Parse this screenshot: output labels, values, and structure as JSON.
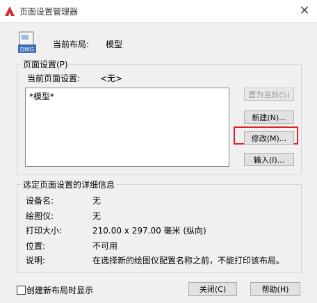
{
  "window": {
    "title": "页面设置管理器",
    "close_glyph": "✕"
  },
  "current_layout": {
    "label": "当前布局:",
    "value": "模型"
  },
  "page_setup": {
    "group_title": "页面设置(P)",
    "current_label": "当前页面设置:",
    "current_value": "<无>",
    "list_items": [
      "*模型*"
    ],
    "buttons": {
      "set_current": "置为当前(S)",
      "new": "新建(N)...",
      "modify": "修改(M)...",
      "import": "输入(I)..."
    }
  },
  "details": {
    "group_title": "选定页面设置的详细信息",
    "rows": [
      {
        "label": "设备名:",
        "value": "无"
      },
      {
        "label": "绘图仪:",
        "value": "无"
      },
      {
        "label": "打印大小:",
        "value": "210.00 x 297.00 毫米 (纵向)"
      },
      {
        "label": "位置:",
        "value": "不可用"
      },
      {
        "label": "说明:",
        "value": "在选择新的绘图仪配置名称之前，不能打印该布局。"
      }
    ]
  },
  "footer": {
    "checkbox_label": "创建新布局时显示",
    "checkbox_checked": false,
    "close_label": "关闭(C)",
    "help_label": "帮助(H)"
  },
  "colors": {
    "highlight": "#e41e25",
    "app_icon": "#d32f2f"
  }
}
